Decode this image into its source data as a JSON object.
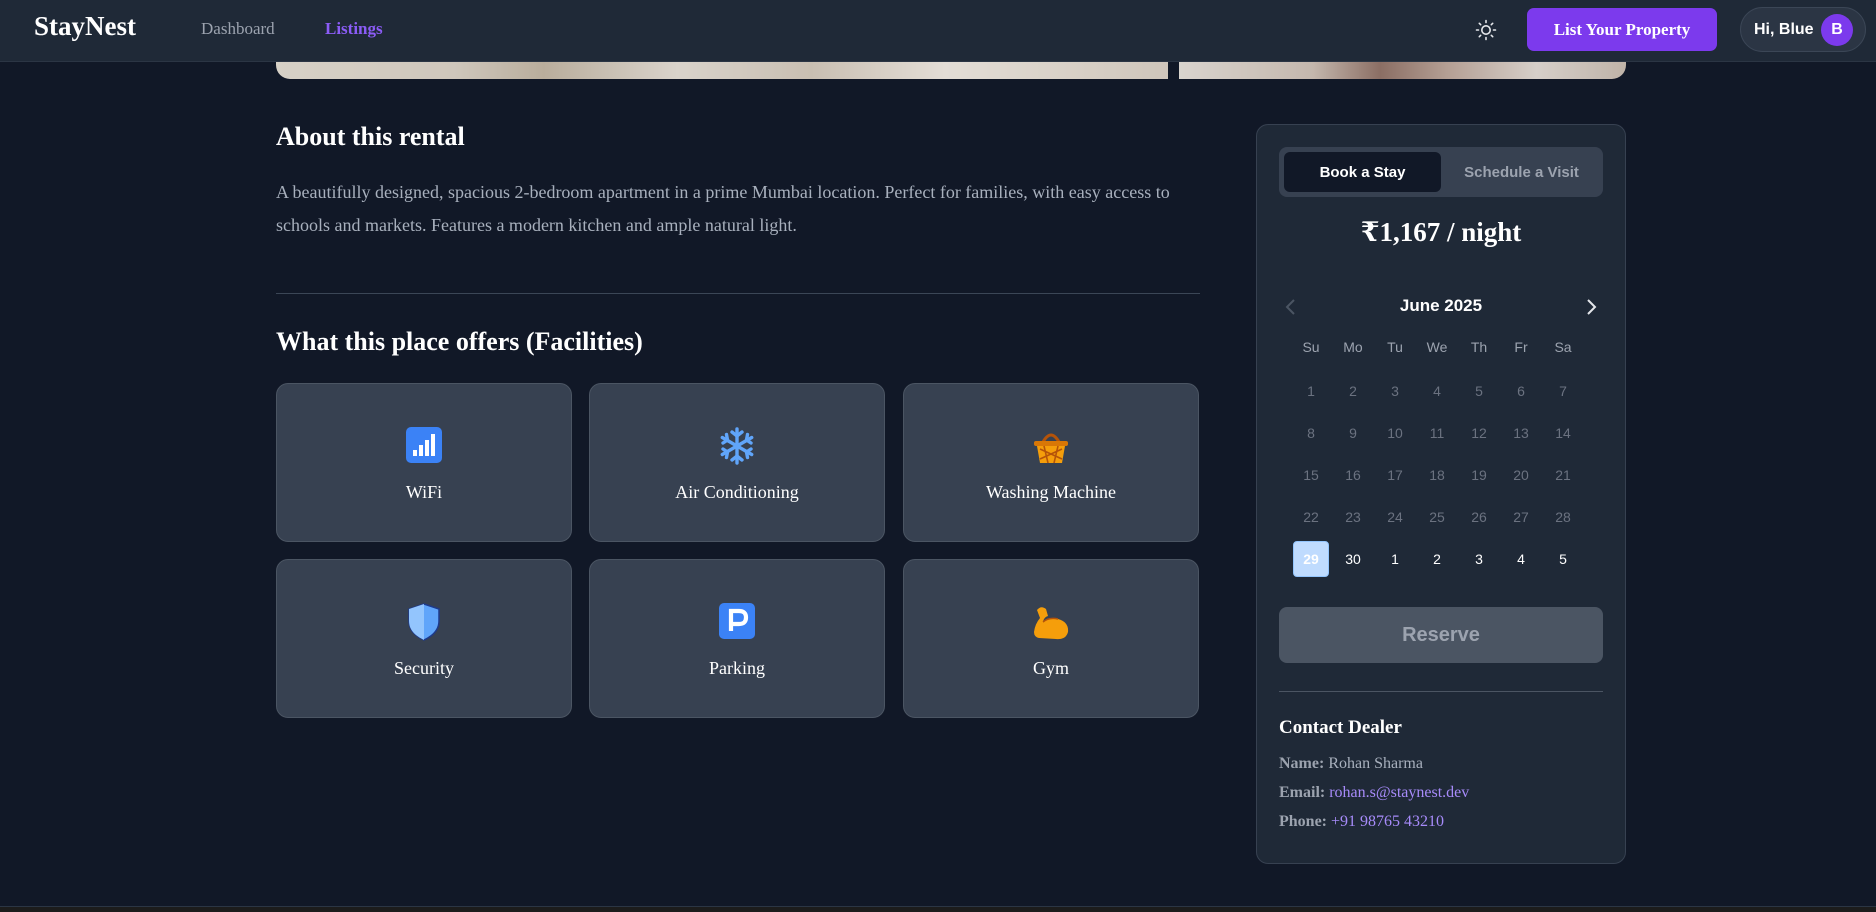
{
  "nav": {
    "brand": "StayNest",
    "links": [
      "Dashboard",
      "Listings"
    ],
    "active_link": "Listings",
    "list_property": "List Your Property",
    "greeting": "Hi, Blue",
    "avatar_initial": "B"
  },
  "about": {
    "heading": "About this rental",
    "description": "A beautifully designed, spacious 2-bedroom apartment in a prime Mumbai location. Perfect for families, with easy access to schools and markets. Features a modern kitchen and ample natural light."
  },
  "facilities": {
    "heading": "What this place offers (Facilities)",
    "items": [
      {
        "label": "WiFi",
        "icon": "wifi-signal-icon"
      },
      {
        "label": "Air Conditioning",
        "icon": "snowflake-icon"
      },
      {
        "label": "Washing Machine",
        "icon": "basket-icon"
      },
      {
        "label": "Security",
        "icon": "shield-icon"
      },
      {
        "label": "Parking",
        "icon": "parking-icon"
      },
      {
        "label": "Gym",
        "icon": "flexed-bicep-icon"
      }
    ]
  },
  "booking": {
    "tabs": [
      "Book a Stay",
      "Schedule a Visit"
    ],
    "active_tab": "Book a Stay",
    "price": "₹1,167 / night",
    "calendar": {
      "month": "June 2025",
      "weekdays": [
        "Su",
        "Mo",
        "Tu",
        "We",
        "Th",
        "Fr",
        "Sa"
      ],
      "days": [
        "1",
        "2",
        "3",
        "4",
        "5",
        "6",
        "7",
        "8",
        "9",
        "10",
        "11",
        "12",
        "13",
        "14",
        "15",
        "16",
        "17",
        "18",
        "19",
        "20",
        "21",
        "22",
        "23",
        "24",
        "25",
        "26",
        "27",
        "28",
        "29",
        "30",
        "1",
        "2",
        "3",
        "4",
        "5"
      ],
      "selected": "29"
    },
    "reserve": "Reserve",
    "accent_color": "#7c3aed"
  },
  "contact": {
    "title": "Contact Dealer",
    "name_label": "Name:",
    "name": "Rohan Sharma",
    "email_label": "Email:",
    "email": "rohan.s@staynest.dev",
    "phone_label": "Phone:",
    "phone": "+91 98765 43210"
  }
}
